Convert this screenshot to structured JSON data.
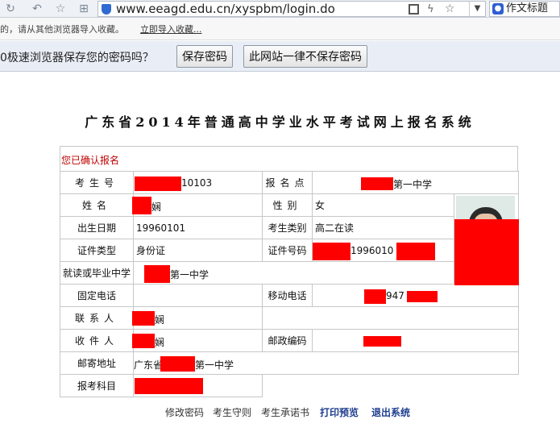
{
  "browser": {
    "url": "www.eeagd.edu.cn/xyspbm/login.do",
    "search_query": "作文标题",
    "favbar_message": "的，请从其他浏览器导入收藏。",
    "favbar_link": "立即导入收藏...",
    "password_prompt": "0极速浏览器保存您的密码吗？",
    "save_password": "保存密码",
    "never_save": "此网站一律不保存密码"
  },
  "page": {
    "title": "广东省2014年普通高中学业水平考试网上报名系统",
    "confirm_message": "您已确认报名"
  },
  "form": {
    "exam_no_label": "考生号",
    "exam_no_value": "10103",
    "site_label": "报名点",
    "site_value": "第一中学",
    "name_label": "姓名",
    "name_value": "娴",
    "gender_label": "性别",
    "gender_value": "女",
    "birth_label": "出生日期",
    "birth_value": "19960101",
    "category_label": "考生类别",
    "category_value": "高二在读",
    "id_type_label": "证件类型",
    "id_type_value": "身份证",
    "id_no_label": "证件号码",
    "id_no_value": "1996010",
    "school_label": "就读或毕业中学",
    "school_value": "第一中学",
    "phone_label": "固定电话",
    "phone_value": "",
    "mobile_label": "移动电话",
    "mobile_value": "947",
    "contact_label": "联系人",
    "contact_value": "娴",
    "recipient_label": "收件人",
    "recipient_value": "娴",
    "postcode_label": "邮政编码",
    "postcode_value": "",
    "address_label": "邮寄地址",
    "address_value_prefix": "广东省",
    "address_value_suffix": "第一中学",
    "subjects_label": "报考科目",
    "subjects_value": ""
  },
  "footer": {
    "change_password": "修改密码",
    "rules": "考生守则",
    "pledge": "考生承诺书",
    "print_preview": "打印预览",
    "logout": "退出系统"
  },
  "colors": {
    "confirm_text": "#c00000",
    "redaction": "#ff0000",
    "footer_link": "#1f3f8f"
  }
}
